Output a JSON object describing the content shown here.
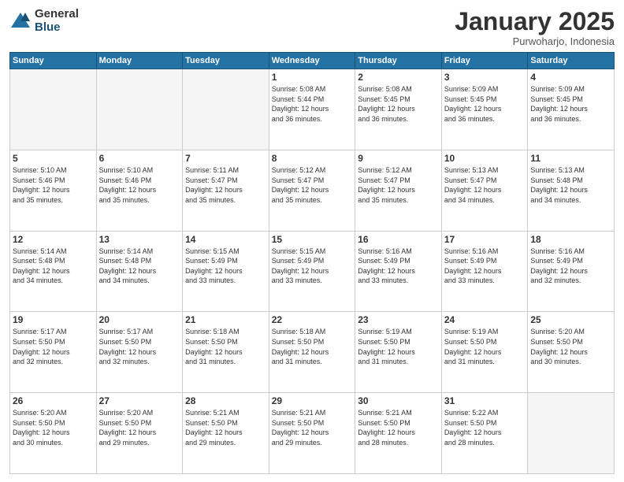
{
  "logo": {
    "general": "General",
    "blue": "Blue"
  },
  "header": {
    "month": "January 2025",
    "location": "Purwoharjo, Indonesia"
  },
  "weekdays": [
    "Sunday",
    "Monday",
    "Tuesday",
    "Wednesday",
    "Thursday",
    "Friday",
    "Saturday"
  ],
  "weeks": [
    [
      {
        "day": "",
        "info": ""
      },
      {
        "day": "",
        "info": ""
      },
      {
        "day": "",
        "info": ""
      },
      {
        "day": "1",
        "info": "Sunrise: 5:08 AM\nSunset: 5:44 PM\nDaylight: 12 hours\nand 36 minutes."
      },
      {
        "day": "2",
        "info": "Sunrise: 5:08 AM\nSunset: 5:45 PM\nDaylight: 12 hours\nand 36 minutes."
      },
      {
        "day": "3",
        "info": "Sunrise: 5:09 AM\nSunset: 5:45 PM\nDaylight: 12 hours\nand 36 minutes."
      },
      {
        "day": "4",
        "info": "Sunrise: 5:09 AM\nSunset: 5:45 PM\nDaylight: 12 hours\nand 36 minutes."
      }
    ],
    [
      {
        "day": "5",
        "info": "Sunrise: 5:10 AM\nSunset: 5:46 PM\nDaylight: 12 hours\nand 35 minutes."
      },
      {
        "day": "6",
        "info": "Sunrise: 5:10 AM\nSunset: 5:46 PM\nDaylight: 12 hours\nand 35 minutes."
      },
      {
        "day": "7",
        "info": "Sunrise: 5:11 AM\nSunset: 5:47 PM\nDaylight: 12 hours\nand 35 minutes."
      },
      {
        "day": "8",
        "info": "Sunrise: 5:12 AM\nSunset: 5:47 PM\nDaylight: 12 hours\nand 35 minutes."
      },
      {
        "day": "9",
        "info": "Sunrise: 5:12 AM\nSunset: 5:47 PM\nDaylight: 12 hours\nand 35 minutes."
      },
      {
        "day": "10",
        "info": "Sunrise: 5:13 AM\nSunset: 5:47 PM\nDaylight: 12 hours\nand 34 minutes."
      },
      {
        "day": "11",
        "info": "Sunrise: 5:13 AM\nSunset: 5:48 PM\nDaylight: 12 hours\nand 34 minutes."
      }
    ],
    [
      {
        "day": "12",
        "info": "Sunrise: 5:14 AM\nSunset: 5:48 PM\nDaylight: 12 hours\nand 34 minutes."
      },
      {
        "day": "13",
        "info": "Sunrise: 5:14 AM\nSunset: 5:48 PM\nDaylight: 12 hours\nand 34 minutes."
      },
      {
        "day": "14",
        "info": "Sunrise: 5:15 AM\nSunset: 5:49 PM\nDaylight: 12 hours\nand 33 minutes."
      },
      {
        "day": "15",
        "info": "Sunrise: 5:15 AM\nSunset: 5:49 PM\nDaylight: 12 hours\nand 33 minutes."
      },
      {
        "day": "16",
        "info": "Sunrise: 5:16 AM\nSunset: 5:49 PM\nDaylight: 12 hours\nand 33 minutes."
      },
      {
        "day": "17",
        "info": "Sunrise: 5:16 AM\nSunset: 5:49 PM\nDaylight: 12 hours\nand 33 minutes."
      },
      {
        "day": "18",
        "info": "Sunrise: 5:16 AM\nSunset: 5:49 PM\nDaylight: 12 hours\nand 32 minutes."
      }
    ],
    [
      {
        "day": "19",
        "info": "Sunrise: 5:17 AM\nSunset: 5:50 PM\nDaylight: 12 hours\nand 32 minutes."
      },
      {
        "day": "20",
        "info": "Sunrise: 5:17 AM\nSunset: 5:50 PM\nDaylight: 12 hours\nand 32 minutes."
      },
      {
        "day": "21",
        "info": "Sunrise: 5:18 AM\nSunset: 5:50 PM\nDaylight: 12 hours\nand 31 minutes."
      },
      {
        "day": "22",
        "info": "Sunrise: 5:18 AM\nSunset: 5:50 PM\nDaylight: 12 hours\nand 31 minutes."
      },
      {
        "day": "23",
        "info": "Sunrise: 5:19 AM\nSunset: 5:50 PM\nDaylight: 12 hours\nand 31 minutes."
      },
      {
        "day": "24",
        "info": "Sunrise: 5:19 AM\nSunset: 5:50 PM\nDaylight: 12 hours\nand 31 minutes."
      },
      {
        "day": "25",
        "info": "Sunrise: 5:20 AM\nSunset: 5:50 PM\nDaylight: 12 hours\nand 30 minutes."
      }
    ],
    [
      {
        "day": "26",
        "info": "Sunrise: 5:20 AM\nSunset: 5:50 PM\nDaylight: 12 hours\nand 30 minutes."
      },
      {
        "day": "27",
        "info": "Sunrise: 5:20 AM\nSunset: 5:50 PM\nDaylight: 12 hours\nand 29 minutes."
      },
      {
        "day": "28",
        "info": "Sunrise: 5:21 AM\nSunset: 5:50 PM\nDaylight: 12 hours\nand 29 minutes."
      },
      {
        "day": "29",
        "info": "Sunrise: 5:21 AM\nSunset: 5:50 PM\nDaylight: 12 hours\nand 29 minutes."
      },
      {
        "day": "30",
        "info": "Sunrise: 5:21 AM\nSunset: 5:50 PM\nDaylight: 12 hours\nand 28 minutes."
      },
      {
        "day": "31",
        "info": "Sunrise: 5:22 AM\nSunset: 5:50 PM\nDaylight: 12 hours\nand 28 minutes."
      },
      {
        "day": "",
        "info": ""
      }
    ]
  ]
}
